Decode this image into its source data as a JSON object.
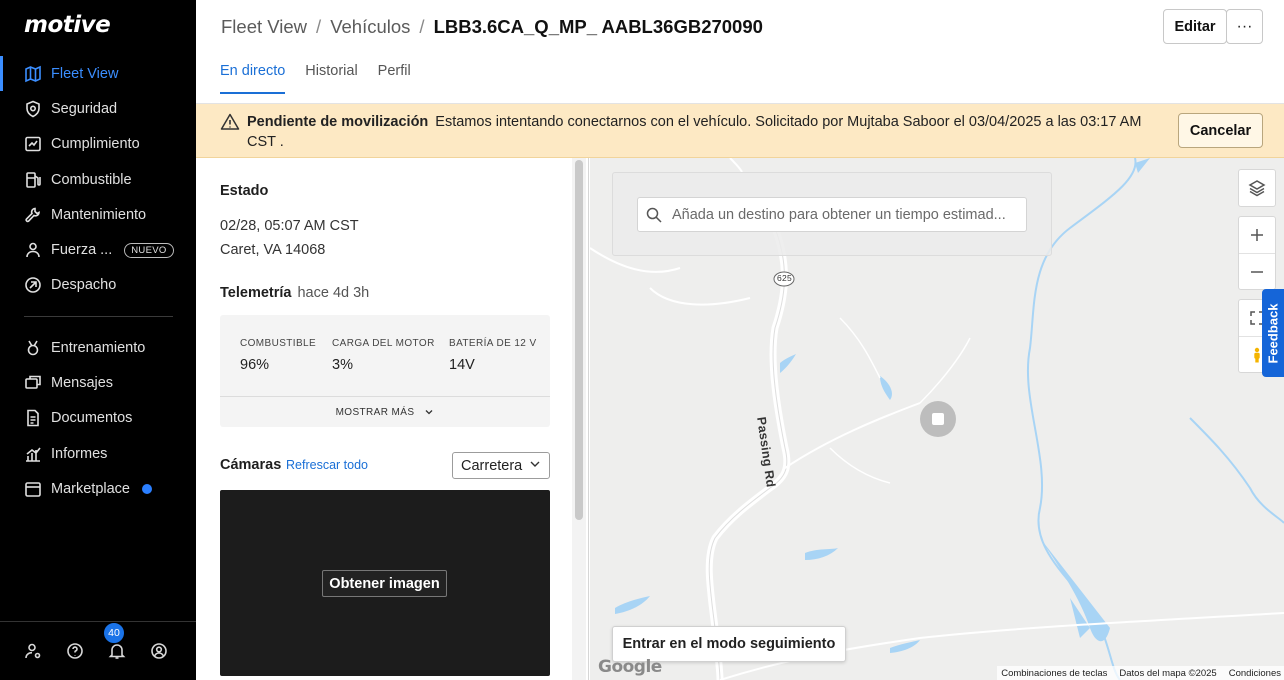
{
  "brand": {
    "logo_text": "motive"
  },
  "sidebar": {
    "items": [
      {
        "label": "Fleet View",
        "icon": "map-icon",
        "active": true
      },
      {
        "label": "Seguridad",
        "icon": "shield-icon"
      },
      {
        "label": "Cumplimiento",
        "icon": "compliance-icon"
      },
      {
        "label": "Combustible",
        "icon": "fuel-icon"
      },
      {
        "label": "Mantenimiento",
        "icon": "wrench-icon"
      },
      {
        "label": "Fuerza ...",
        "icon": "person-icon",
        "badge": "NUEVO"
      },
      {
        "label": "Despacho",
        "icon": "dispatch-icon"
      }
    ],
    "items2": [
      {
        "label": "Entrenamiento",
        "icon": "training-icon"
      },
      {
        "label": "Mensajes",
        "icon": "messages-icon"
      },
      {
        "label": "Documentos",
        "icon": "document-icon"
      },
      {
        "label": "Informes",
        "icon": "reports-icon"
      },
      {
        "label": "Marketplace",
        "icon": "marketplace-icon",
        "dot": true
      }
    ],
    "bottom": {
      "notifications_count": "40"
    }
  },
  "header": {
    "breadcrumb": [
      "Fleet View",
      "Vehículos",
      "LBB3.6CA_Q_MP_ AABL36GB270090"
    ],
    "separator": "/",
    "edit_label": "Editar",
    "more_label": "···",
    "tabs": [
      "En directo",
      "Historial",
      "Perfil"
    ]
  },
  "banner": {
    "title": "Pendiente de movilización",
    "message": "Estamos intentando conectarnos con el vehículo. Solicitado por Mujtaba Saboor el 03/04/2025 a las 03:17 AM CST .",
    "cancel_label": "Cancelar"
  },
  "panel": {
    "status_title": "Estado",
    "status_time": "02/28, 05:07 AM CST",
    "status_location": "Caret, VA 14068",
    "telemetry_title": "Telemetría",
    "telemetry_age": "hace 4d 3h",
    "telemetry": [
      {
        "label": "COMBUSTIBLE",
        "value": "96%"
      },
      {
        "label": "CARGA DEL MOTOR",
        "value": "3%"
      },
      {
        "label": "BATERÍA DE 12 V",
        "value": "14V"
      }
    ],
    "show_more": "MOSTRAR MÁS",
    "cameras_title": "Cámaras",
    "refresh_all": "Refrescar todo",
    "camera_select": "Carretera",
    "get_image": "Obtener imagen"
  },
  "map": {
    "search_placeholder": "Añada un destino para obtener un tiempo estimad...",
    "road_label": "Passing Rd",
    "route_shield": "625",
    "follow_mode": "Entrar en el modo seguimiento",
    "feedback": "Feedback",
    "google": "Google",
    "attribution": [
      "Combinaciones de teclas",
      "Datos del mapa ©2025",
      "Condiciones"
    ],
    "water_color": "#a8d4f5"
  },
  "colors": {
    "accent": "#1a6fd6",
    "banner_bg": "#fde9c4",
    "sidebar_bg": "#000000"
  }
}
